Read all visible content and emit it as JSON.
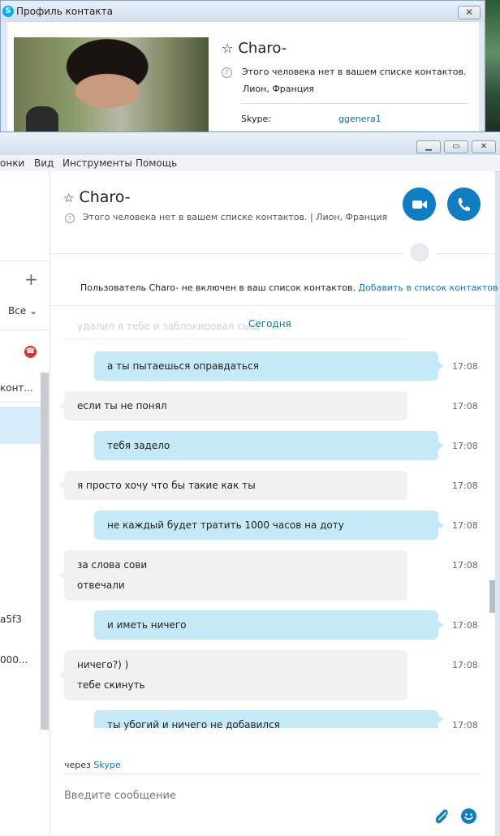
{
  "profile": {
    "title": "Профиль контакта",
    "close": "✕",
    "name": "Charo-",
    "status": "Этого человека нет в вашем списке контактов.",
    "location": "Лион, Франция",
    "skype_label": "Skype:",
    "skype_value": "ggenera1"
  },
  "window": {
    "min": "▁",
    "max": "▭",
    "close": "✕"
  },
  "menu": [
    "онки",
    "Вид",
    "Инструменты",
    "Помощь"
  ],
  "left_panel": {
    "plus": "+",
    "filter": "Все ⌄",
    "item_contact": "конт...",
    "item_a5f3": "a5f3",
    "item_000": "000..."
  },
  "conversation": {
    "name": "Charo-",
    "status": "Этого человека нет в вашем списке контактов.  |  Лион, Франция",
    "notice_text": "Пользователь Charo- не включен в ваш список контактов.",
    "notice_link": "Добавить в список контактов",
    "ghost_message": "удалил я тебе и заблокировал сыщ",
    "today": "Сегодня",
    "messages": [
      {
        "dir": "out",
        "lines": [
          "а ты пытаешься оправдаться"
        ],
        "time": "17:08"
      },
      {
        "dir": "in",
        "lines": [
          "если ты не понял"
        ],
        "time": "17:08"
      },
      {
        "dir": "out",
        "lines": [
          "тебя задело"
        ],
        "time": "17:08"
      },
      {
        "dir": "in",
        "lines": [
          "я просто хочу что бы такие как ты"
        ],
        "time": "17:08"
      },
      {
        "dir": "out",
        "lines": [
          "не каждый будет тратить 1000 часов на доту"
        ],
        "time": "17:08"
      },
      {
        "dir": "in",
        "lines": [
          "за слова сови",
          "отвечали"
        ],
        "time": "17:08"
      },
      {
        "dir": "out",
        "lines": [
          "и иметь ничего"
        ],
        "time": "17:08"
      },
      {
        "dir": "in",
        "lines": [
          "ничего?)  )",
          "тебе скинуть"
        ],
        "time": "17:08"
      },
      {
        "dir": "out",
        "lines": [
          "ты убогий и ничего не добавился"
        ],
        "time": "17:08"
      }
    ],
    "via_prefix": "через",
    "via_link": "Skype",
    "input_placeholder": "Введите сообщение"
  },
  "colors": {
    "accent": "#0f7dc2",
    "bubble_out": "#c6e9f8",
    "bubble_in": "#eff1f3"
  },
  "icons": [
    "star-icon",
    "help-icon",
    "video-call-icon",
    "phone-icon",
    "globe-icon",
    "plus-icon",
    "end-call-icon",
    "attach-icon",
    "emoji-icon",
    "skype-logo-icon"
  ]
}
